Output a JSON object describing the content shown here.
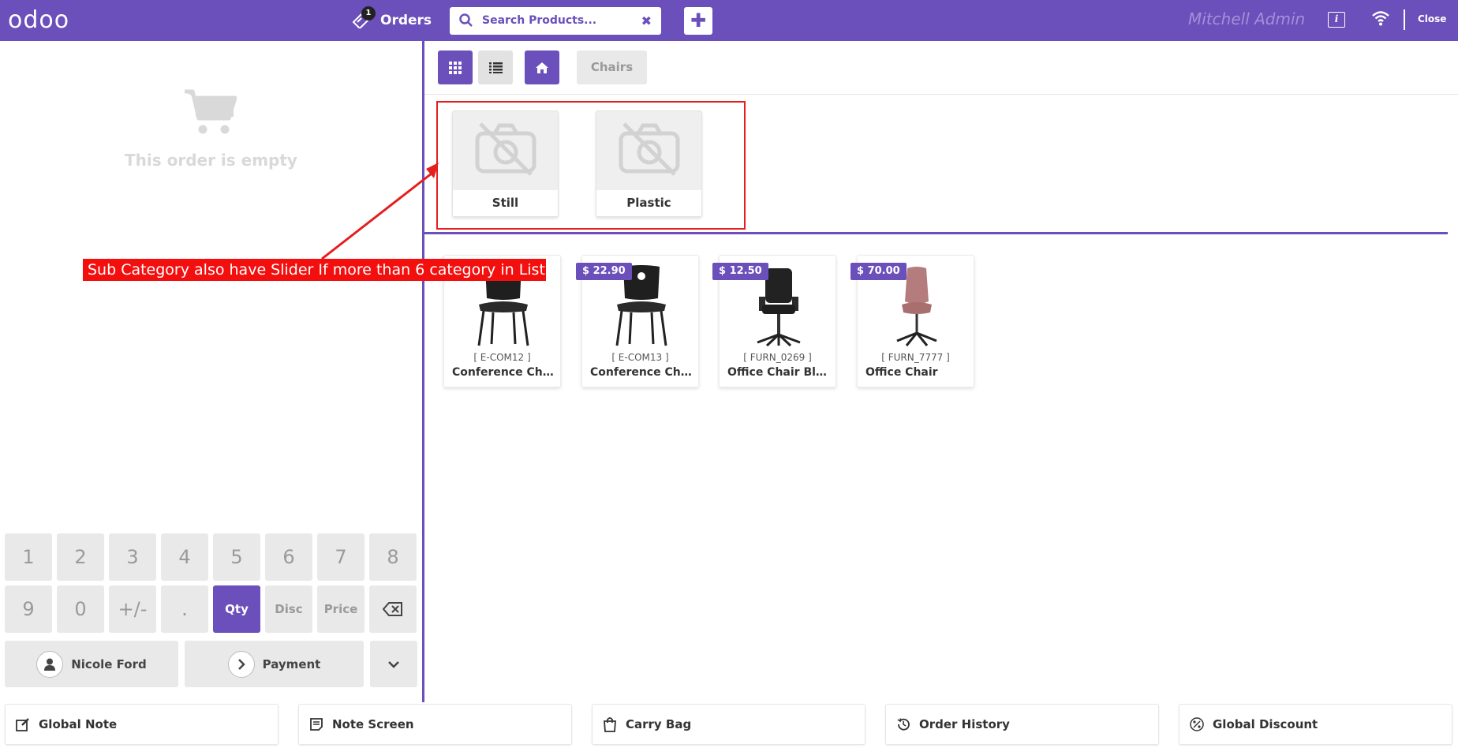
{
  "topbar": {
    "logo": "odoo",
    "orders_label": "Orders",
    "orders_badge": "1",
    "search_placeholder": "Search Products...",
    "user_name": "Mitchell Admin",
    "info_icon": "i",
    "close_label": "Close",
    "accent": "#6b4fbb"
  },
  "order": {
    "empty_text": "This order is empty"
  },
  "numpad": {
    "row1": [
      "1",
      "2",
      "3",
      "4",
      "5",
      "6",
      "7",
      "8"
    ],
    "row2": [
      "9",
      "0",
      "+/-",
      ".",
      "Qty",
      "Disc",
      "Price"
    ],
    "customer": "Nicole Ford",
    "payment": "Payment"
  },
  "breadcrumb": {
    "current": "Chairs"
  },
  "subcategories": [
    {
      "label": "Still"
    },
    {
      "label": "Plastic"
    }
  ],
  "annotation": {
    "text": "Sub Category also have Slider If more than 6 category in List"
  },
  "products": [
    {
      "ref": "[ E-COM12 ]",
      "name": "Conference Chair (Steel)",
      "price": ""
    },
    {
      "ref": "[ E-COM13 ]",
      "name": "Conference Chair (Aluminium)",
      "price": "$ 22.90"
    },
    {
      "ref": "[ FURN_0269 ]",
      "name": "Office Chair Black",
      "price": "$ 12.50"
    },
    {
      "ref": "[ FURN_7777 ]",
      "name": "Office Chair",
      "price": "$ 70.00"
    }
  ],
  "bottom_actions": [
    {
      "label": "Global Note",
      "icon": "edit-icon"
    },
    {
      "label": "Note Screen",
      "icon": "note-icon"
    },
    {
      "label": "Carry Bag",
      "icon": "bag-icon"
    },
    {
      "label": "Order History",
      "icon": "history-icon"
    },
    {
      "label": "Global Discount",
      "icon": "percent-icon"
    }
  ]
}
